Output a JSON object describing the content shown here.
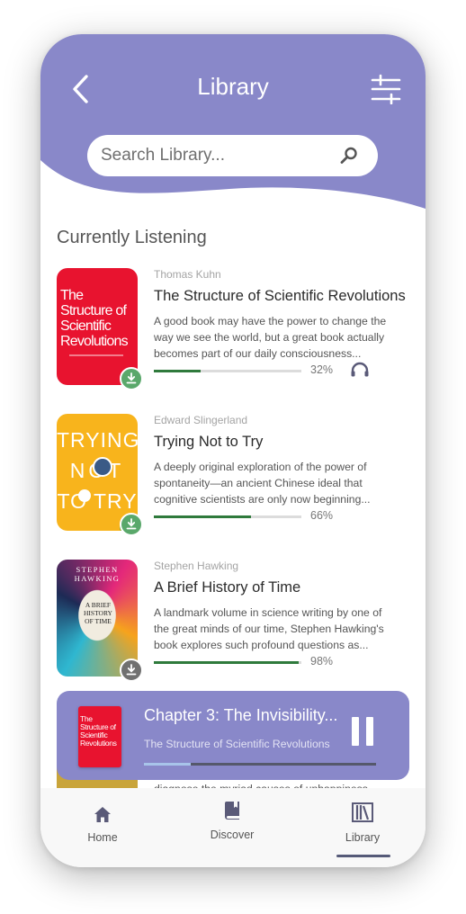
{
  "header": {
    "title": "Library",
    "search_placeholder": "Search Library..."
  },
  "section_title": "Currently Listening",
  "books": [
    {
      "author": "Thomas Kuhn",
      "title": "The Structure of Scientific Revolutions",
      "description": "A good book may have the power to change the way we see the world, but a great book actually becomes part of our daily consciousness...",
      "progress_label": "32%",
      "progress": 0.32,
      "cover_title": "The Structure of Scientific Revolutions",
      "download_state": "downloaded"
    },
    {
      "author": "Edward Slingerland",
      "title": "Trying Not to Try",
      "description": "A deeply original exploration of the power of spontaneity—an ancient Chinese ideal that cognitive scientists are only now beginning...",
      "progress_label": "66%",
      "progress": 0.66,
      "cover_words": [
        "TRYING",
        "NOT",
        "TO TRY"
      ],
      "download_state": "downloaded"
    },
    {
      "author": "Stephen Hawking",
      "title": "A Brief History of Time",
      "description": "A landmark volume in science writing by one of the great minds of our time, Stephen Hawking's book explores such profound questions as...",
      "progress_label": "98%",
      "progress": 0.98,
      "cover_author": "STEPHEN HAWKING",
      "cover_title": "A BRIEF HISTORY OF TIME",
      "download_state": "not-downloaded"
    }
  ],
  "partial_text": "diagnose the myriad causes of unhappiness",
  "player": {
    "chapter": "Chapter 3: The Invisibility...",
    "book": "The Structure of Scientific Revolutions",
    "progress": 0.2
  },
  "nav": [
    {
      "label": "Home",
      "icon": "home-icon"
    },
    {
      "label": "Discover",
      "icon": "book-icon"
    },
    {
      "label": "Library",
      "icon": "library-icon",
      "active": true
    }
  ],
  "colors": {
    "accent": "#8988c9",
    "progress": "#2f7a3c",
    "download_done": "#5aa86b",
    "download_pending": "#707070"
  }
}
